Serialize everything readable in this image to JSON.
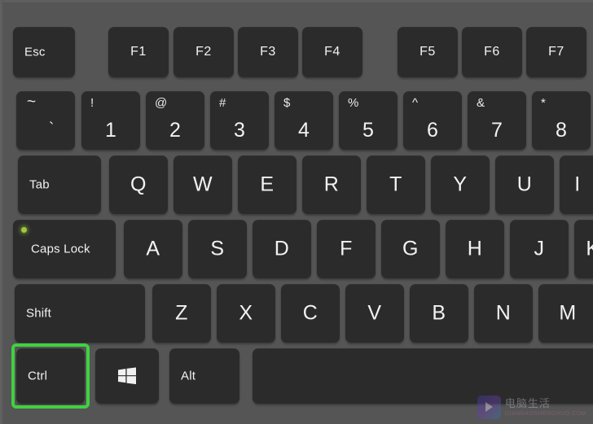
{
  "meta": {
    "subject": "laptop-keyboard-closeup",
    "highlighted_key": "Ctrl",
    "highlight_color": "#3fd23f",
    "key_color": "#2b2b2b",
    "deck_color": "#555555",
    "legend_color": "#f2f2f2",
    "caps_lock_led_color": "#9ec93a"
  },
  "rows": {
    "function_row": [
      {
        "label": "Esc",
        "name": "key-esc"
      },
      {
        "label": "F1",
        "name": "key-f1"
      },
      {
        "label": "F2",
        "name": "key-f2"
      },
      {
        "label": "F3",
        "name": "key-f3"
      },
      {
        "label": "F4",
        "name": "key-f4"
      },
      {
        "label": "F5",
        "name": "key-f5"
      },
      {
        "label": "F6",
        "name": "key-f6"
      },
      {
        "label": "F7",
        "name": "key-f7"
      }
    ],
    "number_row": [
      {
        "shifted": "~",
        "primary": "`",
        "name": "key-backtick"
      },
      {
        "shifted": "!",
        "primary": "1",
        "name": "key-1"
      },
      {
        "shifted": "@",
        "primary": "2",
        "name": "key-2"
      },
      {
        "shifted": "#",
        "primary": "3",
        "name": "key-3"
      },
      {
        "shifted": "$",
        "primary": "4",
        "name": "key-4"
      },
      {
        "shifted": "%",
        "primary": "5",
        "name": "key-5"
      },
      {
        "shifted": "^",
        "primary": "6",
        "name": "key-6"
      },
      {
        "shifted": "&",
        "primary": "7",
        "name": "key-7"
      },
      {
        "shifted": "*",
        "primary": "8",
        "name": "key-8"
      }
    ],
    "top_letter_row": [
      {
        "label": "Tab",
        "name": "key-tab"
      },
      {
        "label": "Q",
        "name": "key-q"
      },
      {
        "label": "W",
        "name": "key-w"
      },
      {
        "label": "E",
        "name": "key-e"
      },
      {
        "label": "R",
        "name": "key-r"
      },
      {
        "label": "T",
        "name": "key-t"
      },
      {
        "label": "Y",
        "name": "key-y"
      },
      {
        "label": "U",
        "name": "key-u"
      },
      {
        "label": "I",
        "name": "key-i"
      }
    ],
    "home_row": [
      {
        "label": "Caps Lock",
        "name": "key-caps-lock"
      },
      {
        "label": "A",
        "name": "key-a"
      },
      {
        "label": "S",
        "name": "key-s"
      },
      {
        "label": "D",
        "name": "key-d"
      },
      {
        "label": "F",
        "name": "key-f"
      },
      {
        "label": "G",
        "name": "key-g"
      },
      {
        "label": "H",
        "name": "key-h"
      },
      {
        "label": "J",
        "name": "key-j"
      },
      {
        "label": "K",
        "name": "key-k"
      }
    ],
    "bottom_letter_row": [
      {
        "label": "Shift",
        "name": "key-shift"
      },
      {
        "label": "Z",
        "name": "key-z"
      },
      {
        "label": "X",
        "name": "key-x"
      },
      {
        "label": "C",
        "name": "key-c"
      },
      {
        "label": "V",
        "name": "key-v"
      },
      {
        "label": "B",
        "name": "key-b"
      },
      {
        "label": "N",
        "name": "key-n"
      },
      {
        "label": "M",
        "name": "key-m"
      }
    ],
    "modifier_row": [
      {
        "label": "Ctrl",
        "name": "key-ctrl",
        "highlighted": true
      },
      {
        "label": "",
        "name": "key-windows",
        "icon": "windows-logo-icon"
      },
      {
        "label": "Alt",
        "name": "key-alt"
      },
      {
        "label": "",
        "name": "key-spacebar"
      }
    ]
  },
  "watermark": {
    "chinese": "电脑生活",
    "latin": "DIANNAOSHENGHUO.COM"
  }
}
